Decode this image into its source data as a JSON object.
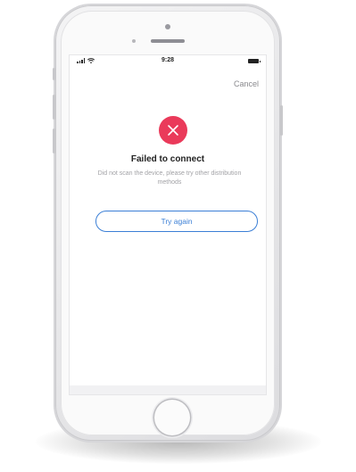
{
  "status_bar": {
    "time": "9:28",
    "signal_icon": "cellular-signal-icon",
    "wifi_icon": "wifi-icon",
    "battery_icon": "battery-icon"
  },
  "header": {
    "cancel_label": "Cancel"
  },
  "result": {
    "icon": "error-x-icon",
    "icon_color": "#ea3a5a",
    "title": "Failed to connect",
    "description": "Did not scan the device, please try other distribution methods"
  },
  "actions": {
    "retry_label": "Try again",
    "accent_color": "#3b7fd6"
  },
  "device": {
    "home_button_icon": "home-button"
  }
}
